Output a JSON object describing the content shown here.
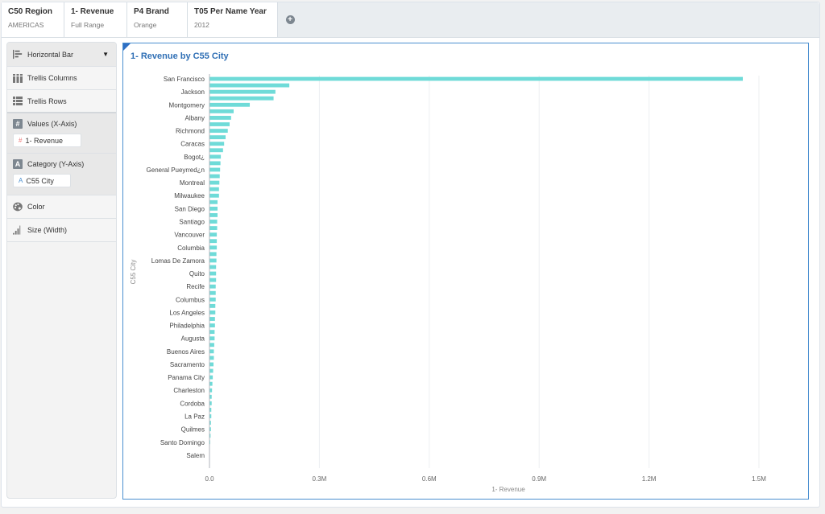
{
  "filters": [
    {
      "title": "C50 Region",
      "value": "AMERICAS"
    },
    {
      "title": "1- Revenue",
      "value": "Full Range"
    },
    {
      "title": "P4 Brand",
      "value": "Orange"
    },
    {
      "title": "T05 Per Name Year",
      "value": "2012"
    }
  ],
  "add_filter_icon": "plus-circle-icon",
  "left_panel": {
    "chart_type": "Horizontal Bar",
    "trellis_columns": "Trellis Columns",
    "trellis_rows": "Trellis Rows",
    "values_label": "Values (X-Axis)",
    "values_pill": "1- Revenue",
    "category_label": "Category (Y-Axis)",
    "category_pill": "C55 City",
    "color_label": "Color",
    "size_label": "Size (Width)"
  },
  "chart_data": {
    "type": "bar",
    "orientation": "horizontal",
    "title": "1- Revenue by C55 City",
    "xlabel": "1- Revenue",
    "ylabel": "C55 City",
    "xlim": [
      0,
      1.5
    ],
    "x_unit": "M",
    "x_ticks": [
      "0.0",
      "0.3M",
      "0.6M",
      "0.9M",
      "1.2M",
      "1.5M"
    ],
    "x_tick_values": [
      0,
      0.3,
      0.6,
      0.9,
      1.2,
      1.5
    ],
    "grid": true,
    "bar_color": "#6fdbd8",
    "categories_labeled": [
      "San Francisco",
      "Jackson",
      "Montgomery",
      "Albany",
      "Richmond",
      "Caracas",
      "Bogot¿",
      "General Pueyrred¿n",
      "Montreal",
      "Milwaukee",
      "San Diego",
      "Santiago",
      "Vancouver",
      "Columbia",
      "Lomas De Zamora",
      "Quito",
      "Recife",
      "Columbus",
      "Los Angeles",
      "Philadelphia",
      "Augusta",
      "Buenos Aires",
      "Sacramento",
      "Panama City",
      "Charleston",
      "Cordoba",
      "La Paz",
      "Quilmes",
      "Santo Domingo",
      "Salem"
    ],
    "values": [
      1.456,
      0.218,
      0.18,
      0.175,
      0.11,
      0.066,
      0.059,
      0.055,
      0.05,
      0.044,
      0.04,
      0.037,
      0.031,
      0.03,
      0.029,
      0.028,
      0.027,
      0.026,
      0.026,
      0.022,
      0.022,
      0.022,
      0.021,
      0.021,
      0.02,
      0.02,
      0.02,
      0.019,
      0.019,
      0.018,
      0.018,
      0.018,
      0.017,
      0.017,
      0.017,
      0.016,
      0.016,
      0.015,
      0.015,
      0.014,
      0.014,
      0.013,
      0.012,
      0.012,
      0.011,
      0.01,
      0.009,
      0.008,
      0.007,
      0.006,
      0.006,
      0.005,
      0.005,
      0.004,
      0.004,
      0.003,
      0.002,
      0.001,
      0.0003,
      0.0001
    ]
  }
}
